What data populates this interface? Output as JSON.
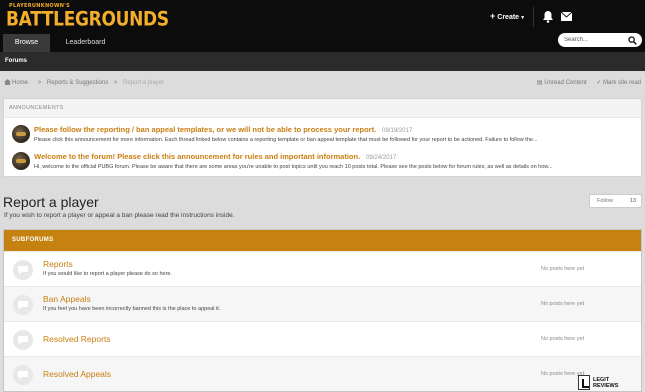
{
  "header": {
    "logo_small": "PLAYERUNKNOWN'S",
    "logo_big": "BATTLEGROUNDS",
    "create_label": "Create",
    "icons": {
      "notifications": "bell-icon",
      "messages": "mail-icon"
    },
    "brand_color": "#f3ae2b"
  },
  "nav": {
    "tabs": [
      {
        "label": "Browse",
        "active": true
      },
      {
        "label": "Leaderboard",
        "active": false
      }
    ],
    "search_placeholder": "Search...",
    "sub_label": "Forums"
  },
  "breadcrumb": {
    "home": "Home",
    "sep": ">",
    "section": "Reports & Suggestions",
    "current": "Report a player"
  },
  "quick_links": {
    "unread": "Unread Content",
    "mark_read": "Mark site read"
  },
  "announcements": {
    "heading": "ANNOUNCEMENTS",
    "items": [
      {
        "title": "Please follow the reporting / ban appeal templates, or we will not be able to process your report.",
        "date": "09/19/2017",
        "snippet": "Please click this announcement for more information. Each thread linked below contains a reporting template or ban appeal template that must be followed for your report to be actioned. Failure to follow the..."
      },
      {
        "title": "Welcome to the forum! Please click this announcement for rules and important information.",
        "date": "09/24/2017",
        "snippet": "Hi, welcome to the official PUBG forum. Please be aware that there are some areas you're unable to post topics until you reach 10 posts total. Please see the posts below for forum rules, as well as details on how..."
      }
    ]
  },
  "page": {
    "title": "Report a player",
    "description": "If you wish to report a player or appeal a ban please read the instructions inside.",
    "follow_label": "Follow",
    "follow_count": "13"
  },
  "subforums": {
    "heading": "SUBFORUMS",
    "accent_color": "#c68210",
    "items": [
      {
        "title": "Reports",
        "description": "If you would like to report a player please do so here.",
        "last": "No posts here yet"
      },
      {
        "title": "Ban Appeals",
        "description": "If you feel you have been incorrectly banned this is the place to appeal it.",
        "last": "No posts here yet"
      },
      {
        "title": "Resolved Reports",
        "description": "",
        "last": "No posts here yet"
      },
      {
        "title": "Resolved Appeals",
        "description": "",
        "last": "No posts here yet"
      }
    ]
  },
  "watermark": {
    "line1": "LEGIT",
    "line2": "REVIEWS"
  }
}
